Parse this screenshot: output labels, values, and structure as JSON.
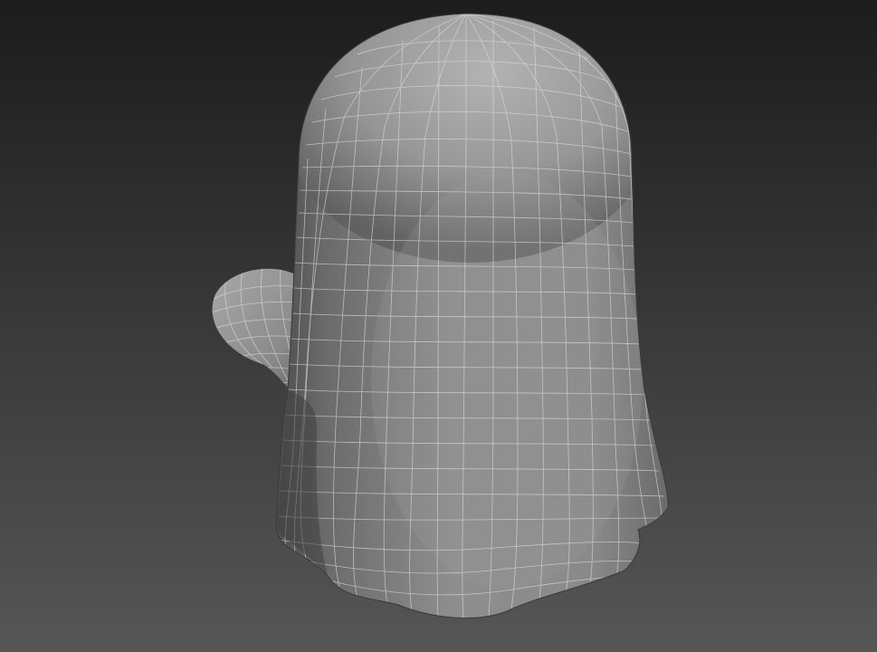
{
  "viewport": {
    "background_top": "#1c1c1c",
    "background_bottom": "#565656",
    "shading": "smooth-wireframe",
    "wire_color": "#d8d8d8"
  },
  "model": {
    "object": "ghost-mesh",
    "surface_light": "#b7b7b7",
    "surface_mid": "#8c8c8c",
    "surface_dark": "#4a4a4a"
  }
}
